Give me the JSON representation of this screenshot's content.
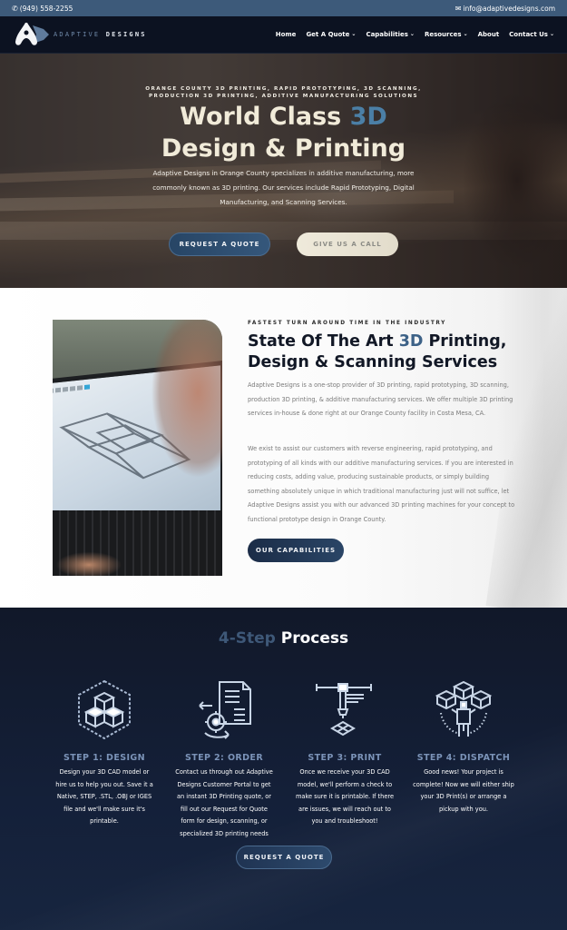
{
  "topbar": {
    "phone": "(949) 558-2255",
    "email": "info@adaptivedesigns.com",
    "phone_icon": "phone-icon",
    "email_icon": "envelope-icon"
  },
  "nav": {
    "logo_text_a": "ADAPTIVE",
    "logo_text_b": "DESIGNS",
    "items": [
      {
        "label": "Home",
        "dropdown": false
      },
      {
        "label": "Get A Quote",
        "dropdown": true
      },
      {
        "label": "Capabilities",
        "dropdown": true
      },
      {
        "label": "Resources",
        "dropdown": true
      },
      {
        "label": "About",
        "dropdown": false
      },
      {
        "label": "Contact Us",
        "dropdown": true
      }
    ],
    "chevron": "⌄"
  },
  "hero": {
    "kicker_line1": "ORANGE COUNTY 3D PRINTING, RAPID PROTOTYPING, 3D SCANNING,",
    "kicker_line2": "PRODUCTION 3D PRINTING, ADDITIVE MANUFACTURING SOLUTIONS",
    "title_part1": "World Class ",
    "title_accent": "3D",
    "title_line2": "Design & Printing",
    "description": "Adaptive Designs in Orange County specializes in additive manufacturing, more commonly known as 3D printing. Our services include Rapid Prototyping, Digital Manufacturing, and Scanning Services.",
    "primary_button": "REQUEST A QUOTE",
    "secondary_button": "GIVE US A CALL"
  },
  "about": {
    "kicker": "FASTEST TURN AROUND TIME IN THE INDUSTRY",
    "title_part1": "State Of The Art ",
    "title_accent": "3D",
    "title_part2": " Printing, Design & Scanning Services",
    "paragraph1": "Adaptive Designs is a one-stop provider of 3D printing, rapid prototyping, 3D scanning, production 3D printing, & additive manufacturing services. We offer multiple 3D printing services in-house & done right at our Orange County facility in Costa Mesa, CA.",
    "paragraph2": "We exist to assist our customers with reverse engineering, rapid prototyping, and prototyping of all kinds with our additive manufacturing services. If you are interested in reducing costs, adding value, producing sustainable products, or simply building something absolutely unique in which traditional manufacturing just will not suffice, let Adaptive Designs assist you with our advanced 3D printing machines for your concept to functional prototype design in Orange County.",
    "button": "OUR CAPABILITIES"
  },
  "process": {
    "title_accent": "4-Step",
    "title_rest": " Process",
    "steps": [
      {
        "icon": "cubes-hexagon-icon",
        "title": "STEP 1: DESIGN",
        "description": "Design your 3D CAD model or hire us to help you out. Save it a Native, STEP, .STL, .OBJ or IGES file and we'll make sure it's printable."
      },
      {
        "icon": "document-gear-icon",
        "title": "STEP 2: ORDER",
        "description": "Contact us through out Adaptive Designs Customer Portal to get an instant 3D Printing quote, or fill out our Request for Quote form for design, scanning, or specialized 3D printing needs"
      },
      {
        "icon": "3d-printer-icon",
        "title": "STEP 3: PRINT",
        "description": "Once we receive your 3D CAD model, we'll perform a check to make sure it is printable. If there are issues, we will reach out to you and troubleshoot!"
      },
      {
        "icon": "person-with-boxes-icon",
        "title": "STEP 4: DISPATCH",
        "description": "Good news! Your project is complete! Now we will either ship your 3D Print(s) or arrange a pickup with you."
      }
    ],
    "button": "REQUEST A QUOTE"
  },
  "colors": {
    "topbar": "#3d5a7a",
    "nav": "#0c1221",
    "accent_blue": "#4b7fa6",
    "dark_navy": "#121826",
    "step_title": "#7b93b8"
  }
}
